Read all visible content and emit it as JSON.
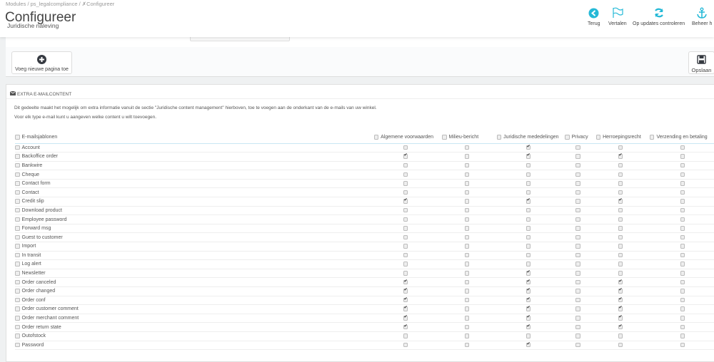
{
  "breadcrumb": [
    "Modules",
    "ps_legalcompliance",
    "Configureer"
  ],
  "header": {
    "title": "Configureer",
    "subtitle": "Juridische naleving"
  },
  "toolbar": [
    {
      "label": "Terug",
      "icon": "back-circle-icon"
    },
    {
      "label": "Vertalen",
      "icon": "flag-icon"
    },
    {
      "label": "Op updates controleren",
      "icon": "refresh-icon"
    },
    {
      "label": "Beheer h",
      "icon": "anchor-icon"
    }
  ],
  "add_page_label": "Voeg nieuwe pagina toe",
  "save_label": "Opslaan",
  "panel": {
    "title": "EXTRA E-MAILCONTENT",
    "desc1": "Dit gedeelte maakt het mogelijk om extra informatie vanuit de sectie \"Juridische content management\" hierboven, toe te voegen aan de onderkant van de e-mails van uw winkel.",
    "desc2": "Voor elk type e-mail kunt u aangeven welke content u wilt toevoegen."
  },
  "columns": [
    "E-mailsjablonen",
    "Algemene voorwaarden",
    "Milieu-bericht",
    "Juridische mededelingen",
    "Privacy",
    "Herroepingsrecht",
    "Verzending en betaling"
  ],
  "rows": [
    {
      "name": "Account",
      "checks": [
        0,
        0,
        1,
        0,
        0,
        0
      ]
    },
    {
      "name": "Backoffice order",
      "checks": [
        1,
        0,
        1,
        0,
        1,
        0
      ]
    },
    {
      "name": "Bankwire",
      "checks": [
        0,
        0,
        0,
        0,
        0,
        0
      ]
    },
    {
      "name": "Cheque",
      "checks": [
        0,
        0,
        0,
        0,
        0,
        0
      ]
    },
    {
      "name": "Contact form",
      "checks": [
        0,
        0,
        0,
        0,
        0,
        0
      ]
    },
    {
      "name": "Contact",
      "checks": [
        0,
        0,
        0,
        0,
        0,
        0
      ]
    },
    {
      "name": "Credit slip",
      "checks": [
        1,
        0,
        1,
        0,
        1,
        0
      ]
    },
    {
      "name": "Download product",
      "checks": [
        0,
        0,
        0,
        0,
        0,
        0
      ]
    },
    {
      "name": "Employee password",
      "checks": [
        0,
        0,
        0,
        0,
        0,
        0
      ]
    },
    {
      "name": "Forward msg",
      "checks": [
        0,
        0,
        0,
        0,
        0,
        0
      ]
    },
    {
      "name": "Guest to customer",
      "checks": [
        0,
        0,
        0,
        0,
        0,
        0
      ]
    },
    {
      "name": "Import",
      "checks": [
        0,
        0,
        0,
        0,
        0,
        0
      ]
    },
    {
      "name": "In transit",
      "checks": [
        0,
        0,
        0,
        0,
        0,
        0
      ]
    },
    {
      "name": "Log alert",
      "checks": [
        0,
        0,
        0,
        0,
        0,
        0
      ]
    },
    {
      "name": "Newsletter",
      "checks": [
        0,
        0,
        1,
        0,
        0,
        0
      ]
    },
    {
      "name": "Order canceled",
      "checks": [
        1,
        0,
        1,
        0,
        1,
        0
      ]
    },
    {
      "name": "Order changed",
      "checks": [
        1,
        0,
        1,
        0,
        1,
        0
      ]
    },
    {
      "name": "Order conf",
      "checks": [
        1,
        0,
        1,
        0,
        1,
        0
      ]
    },
    {
      "name": "Order customer comment",
      "checks": [
        1,
        0,
        1,
        0,
        1,
        0
      ]
    },
    {
      "name": "Order merchant comment",
      "checks": [
        1,
        0,
        1,
        0,
        1,
        0
      ]
    },
    {
      "name": "Order return state",
      "checks": [
        1,
        0,
        1,
        0,
        1,
        0
      ]
    },
    {
      "name": "Outofstock",
      "checks": [
        0,
        0,
        0,
        0,
        0,
        0
      ]
    },
    {
      "name": "Password",
      "checks": [
        0,
        0,
        1,
        0,
        0,
        0
      ]
    }
  ],
  "colors": {
    "accent": "#25b9d7",
    "text": "#555555"
  }
}
